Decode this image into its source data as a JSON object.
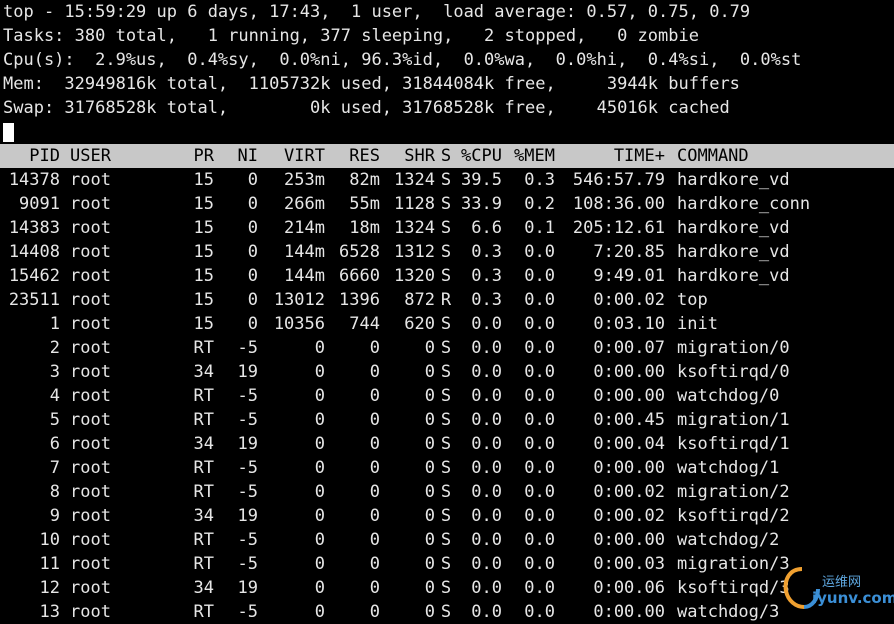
{
  "summary": {
    "line1": "top - 15:59:29 up 6 days, 17:43,  1 user,  load average: 0.57, 0.75, 0.79",
    "line2": "Tasks: 380 total,   1 running, 377 sleeping,   2 stopped,   0 zombie",
    "line3": "Cpu(s):  2.9%us,  0.4%sy,  0.0%ni, 96.3%id,  0.0%wa,  0.0%hi,  0.4%si,  0.0%st",
    "line4": "Mem:  32949816k total,  1105732k used, 31844084k free,     3944k buffers",
    "line5": "Swap: 31768528k total,        0k used, 31768528k free,    45016k cached"
  },
  "headers": {
    "pid": "PID",
    "user": "USER",
    "pr": "PR",
    "ni": "NI",
    "virt": "VIRT",
    "res": "RES",
    "shr": "SHR",
    "s": "S",
    "cpu": "%CPU",
    "mem": "%MEM",
    "time": "TIME+",
    "command": "COMMAND"
  },
  "processes": [
    {
      "pid": "14378",
      "user": "root",
      "pr": "15",
      "ni": "0",
      "virt": "253m",
      "res": "82m",
      "shr": "1324",
      "s": "S",
      "cpu": "39.5",
      "mem": "0.3",
      "time": "546:57.79",
      "command": "hardkore_vd"
    },
    {
      "pid": "9091",
      "user": "root",
      "pr": "15",
      "ni": "0",
      "virt": "266m",
      "res": "55m",
      "shr": "1128",
      "s": "S",
      "cpu": "33.9",
      "mem": "0.2",
      "time": "108:36.00",
      "command": "hardkore_conn"
    },
    {
      "pid": "14383",
      "user": "root",
      "pr": "15",
      "ni": "0",
      "virt": "214m",
      "res": "18m",
      "shr": "1324",
      "s": "S",
      "cpu": "6.6",
      "mem": "0.1",
      "time": "205:12.61",
      "command": "hardkore_vd"
    },
    {
      "pid": "14408",
      "user": "root",
      "pr": "15",
      "ni": "0",
      "virt": "144m",
      "res": "6528",
      "shr": "1312",
      "s": "S",
      "cpu": "0.3",
      "mem": "0.0",
      "time": "7:20.85",
      "command": "hardkore_vd"
    },
    {
      "pid": "15462",
      "user": "root",
      "pr": "15",
      "ni": "0",
      "virt": "144m",
      "res": "6660",
      "shr": "1320",
      "s": "S",
      "cpu": "0.3",
      "mem": "0.0",
      "time": "9:49.01",
      "command": "hardkore_vd"
    },
    {
      "pid": "23511",
      "user": "root",
      "pr": "15",
      "ni": "0",
      "virt": "13012",
      "res": "1396",
      "shr": "872",
      "s": "R",
      "cpu": "0.3",
      "mem": "0.0",
      "time": "0:00.02",
      "command": "top"
    },
    {
      "pid": "1",
      "user": "root",
      "pr": "15",
      "ni": "0",
      "virt": "10356",
      "res": "744",
      "shr": "620",
      "s": "S",
      "cpu": "0.0",
      "mem": "0.0",
      "time": "0:03.10",
      "command": "init"
    },
    {
      "pid": "2",
      "user": "root",
      "pr": "RT",
      "ni": "-5",
      "virt": "0",
      "res": "0",
      "shr": "0",
      "s": "S",
      "cpu": "0.0",
      "mem": "0.0",
      "time": "0:00.07",
      "command": "migration/0"
    },
    {
      "pid": "3",
      "user": "root",
      "pr": "34",
      "ni": "19",
      "virt": "0",
      "res": "0",
      "shr": "0",
      "s": "S",
      "cpu": "0.0",
      "mem": "0.0",
      "time": "0:00.00",
      "command": "ksoftirqd/0"
    },
    {
      "pid": "4",
      "user": "root",
      "pr": "RT",
      "ni": "-5",
      "virt": "0",
      "res": "0",
      "shr": "0",
      "s": "S",
      "cpu": "0.0",
      "mem": "0.0",
      "time": "0:00.00",
      "command": "watchdog/0"
    },
    {
      "pid": "5",
      "user": "root",
      "pr": "RT",
      "ni": "-5",
      "virt": "0",
      "res": "0",
      "shr": "0",
      "s": "S",
      "cpu": "0.0",
      "mem": "0.0",
      "time": "0:00.45",
      "command": "migration/1"
    },
    {
      "pid": "6",
      "user": "root",
      "pr": "34",
      "ni": "19",
      "virt": "0",
      "res": "0",
      "shr": "0",
      "s": "S",
      "cpu": "0.0",
      "mem": "0.0",
      "time": "0:00.04",
      "command": "ksoftirqd/1"
    },
    {
      "pid": "7",
      "user": "root",
      "pr": "RT",
      "ni": "-5",
      "virt": "0",
      "res": "0",
      "shr": "0",
      "s": "S",
      "cpu": "0.0",
      "mem": "0.0",
      "time": "0:00.00",
      "command": "watchdog/1"
    },
    {
      "pid": "8",
      "user": "root",
      "pr": "RT",
      "ni": "-5",
      "virt": "0",
      "res": "0",
      "shr": "0",
      "s": "S",
      "cpu": "0.0",
      "mem": "0.0",
      "time": "0:00.02",
      "command": "migration/2"
    },
    {
      "pid": "9",
      "user": "root",
      "pr": "34",
      "ni": "19",
      "virt": "0",
      "res": "0",
      "shr": "0",
      "s": "S",
      "cpu": "0.0",
      "mem": "0.0",
      "time": "0:00.02",
      "command": "ksoftirqd/2"
    },
    {
      "pid": "10",
      "user": "root",
      "pr": "RT",
      "ni": "-5",
      "virt": "0",
      "res": "0",
      "shr": "0",
      "s": "S",
      "cpu": "0.0",
      "mem": "0.0",
      "time": "0:00.00",
      "command": "watchdog/2"
    },
    {
      "pid": "11",
      "user": "root",
      "pr": "RT",
      "ni": "-5",
      "virt": "0",
      "res": "0",
      "shr": "0",
      "s": "S",
      "cpu": "0.0",
      "mem": "0.0",
      "time": "0:00.03",
      "command": "migration/3"
    },
    {
      "pid": "12",
      "user": "root",
      "pr": "34",
      "ni": "19",
      "virt": "0",
      "res": "0",
      "shr": "0",
      "s": "S",
      "cpu": "0.0",
      "mem": "0.0",
      "time": "0:00.06",
      "command": "ksoftirqd/3"
    },
    {
      "pid": "13",
      "user": "root",
      "pr": "RT",
      "ni": "-5",
      "virt": "0",
      "res": "0",
      "shr": "0",
      "s": "S",
      "cpu": "0.0",
      "mem": "0.0",
      "time": "0:00.00",
      "command": "watchdog/3"
    }
  ],
  "watermark": {
    "cn": "运维网",
    "en": "iyunv.com"
  },
  "colors": {
    "background": "#000000",
    "text": "#e6e6e6",
    "header_bar": "#c8c8c8",
    "watermark": "#3b8fd6"
  }
}
